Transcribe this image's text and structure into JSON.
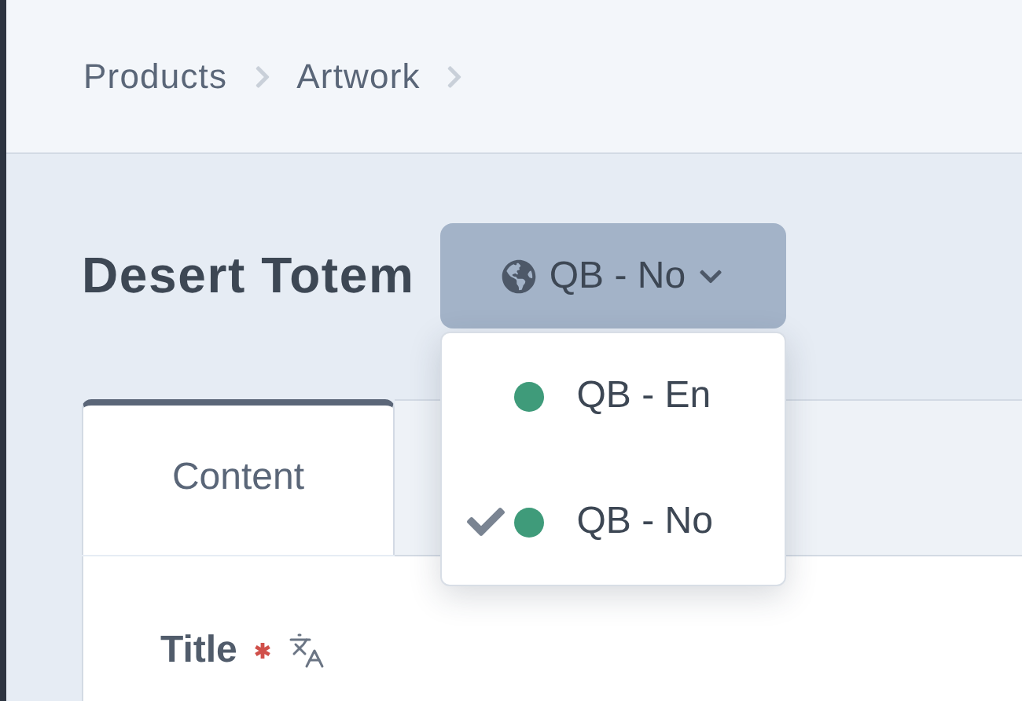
{
  "breadcrumbs": [
    "Products",
    "Artwork"
  ],
  "page_title": "Desert Totem",
  "locale_button": {
    "label": "QB - No",
    "expanded": true
  },
  "locale_menu": [
    {
      "label": "QB - En",
      "color": "#3f9b7a",
      "selected": false
    },
    {
      "label": "QB - No",
      "color": "#3f9b7a",
      "selected": true
    }
  ],
  "tabs": [
    {
      "label": "Content",
      "selected": true
    }
  ],
  "fields": [
    {
      "label": "Title",
      "required": true,
      "translatable": true
    }
  ]
}
